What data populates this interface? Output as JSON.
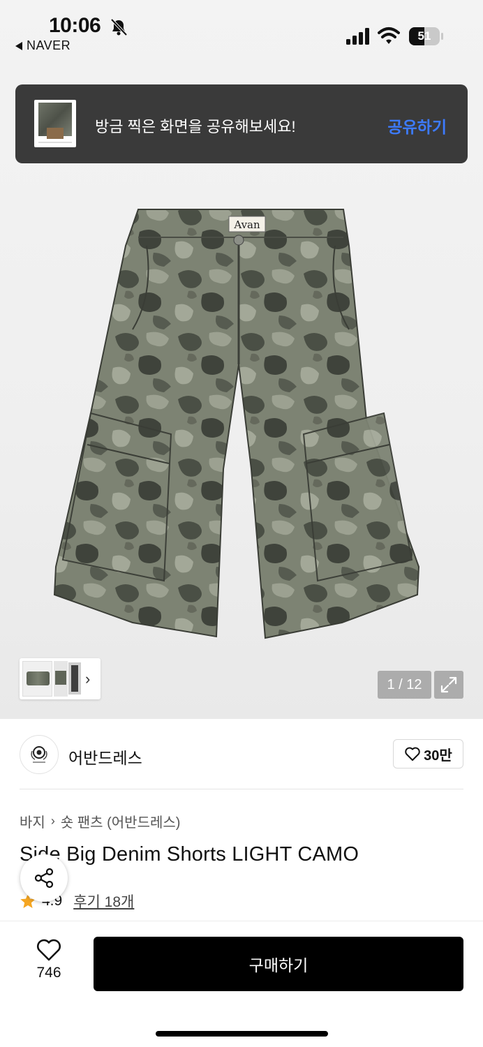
{
  "status_bar": {
    "time": "10:06",
    "back_app": "NAVER",
    "battery_level": "51"
  },
  "share_toast": {
    "message": "방금 찍은 화면을 공유해보세요!",
    "action": "공유하기",
    "action_color": "#3d7bff"
  },
  "gallery": {
    "image_label": "Avan",
    "counter": "1 / 12"
  },
  "store": {
    "name": "어반드레스",
    "follow_count": "30만"
  },
  "product": {
    "breadcrumb": [
      "바지",
      "숏 팬츠 (어반드레스)"
    ],
    "title": "Side Big Denim Shorts LIGHT CAMO",
    "rating": "4.9",
    "reviews": "후기 18개",
    "star_color": "#f5a623"
  },
  "bottom_bar": {
    "like_count": "746",
    "buy_label": "구매하기"
  }
}
